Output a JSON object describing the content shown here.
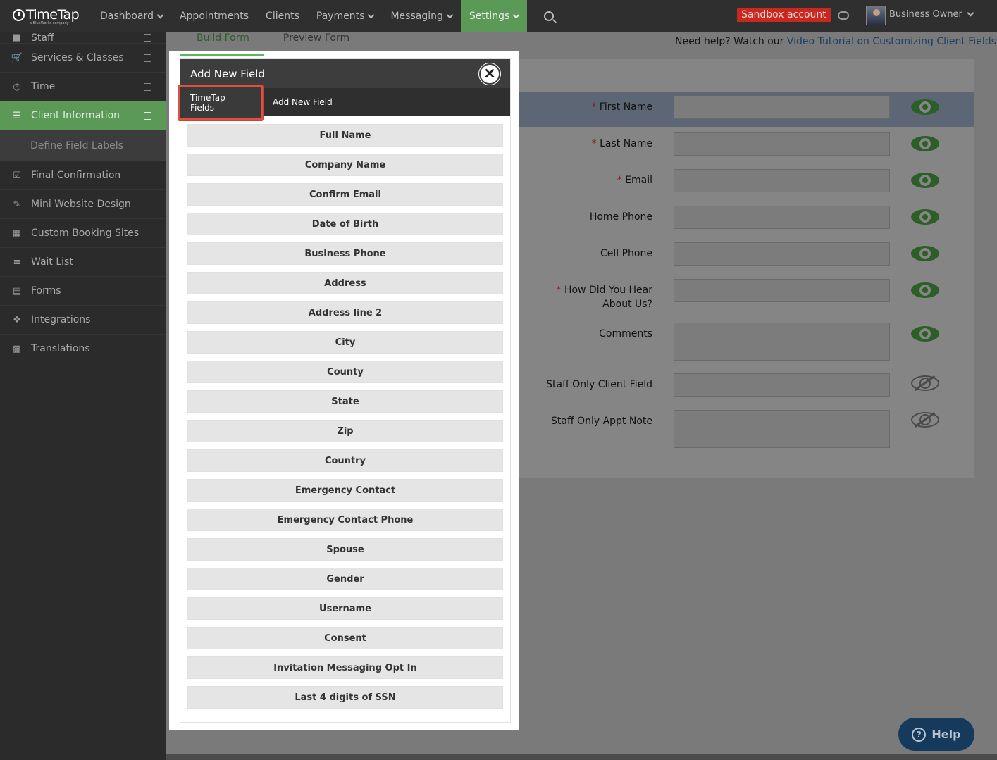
{
  "topbar": {
    "logo": "TimeTap",
    "logo_sub": "a BlueWorks company",
    "nav": [
      {
        "label": "Dashboard",
        "dropdown": true,
        "active": false
      },
      {
        "label": "Appointments",
        "dropdown": false,
        "active": false
      },
      {
        "label": "Clients",
        "dropdown": false,
        "active": false
      },
      {
        "label": "Payments",
        "dropdown": true,
        "active": false
      },
      {
        "label": "Messaging",
        "dropdown": true,
        "active": false
      },
      {
        "label": "Settings",
        "dropdown": true,
        "active": true
      }
    ],
    "sandbox_label": "Sandbox account",
    "user_name": "Business Owner"
  },
  "sidebar": {
    "items": [
      {
        "label": "Staff",
        "icon": "staff-icon"
      },
      {
        "label": "Services & Classes",
        "icon": "cart-icon"
      },
      {
        "label": "Time",
        "icon": "clock-icon"
      },
      {
        "label": "Client Information",
        "icon": "list-icon",
        "active": true
      },
      {
        "label": "Define Field Labels",
        "sub": true
      },
      {
        "label": "Final Confirmation",
        "icon": "checkbox-icon"
      },
      {
        "label": "Mini Website Design",
        "icon": "edit-icon"
      },
      {
        "label": "Custom Booking Sites",
        "icon": "sitemap-icon"
      },
      {
        "label": "Wait List",
        "icon": "wait-list-icon"
      },
      {
        "label": "Forms",
        "icon": "file-icon"
      },
      {
        "label": "Integrations",
        "icon": "puzzle-icon"
      },
      {
        "label": "Translations",
        "icon": "translate-icon"
      }
    ]
  },
  "main": {
    "tabs": [
      "Build Form",
      "Preview Form"
    ],
    "help_prefix": "Need help? Watch our ",
    "help_link": "Video Tutorial on Customizing Client Fields",
    "form_fields": [
      {
        "label": "First Name",
        "required": true,
        "visible": true
      },
      {
        "label": "Last Name",
        "required": true,
        "visible": true
      },
      {
        "label": "Email",
        "required": true,
        "visible": true
      },
      {
        "label": "Home Phone",
        "required": false,
        "visible": true
      },
      {
        "label": "Cell Phone",
        "required": false,
        "visible": true
      },
      {
        "label": "How Did You Hear About Us?",
        "required": true,
        "visible": true
      },
      {
        "label": "Comments",
        "required": false,
        "visible": true
      },
      {
        "label": "Staff Only Client Field",
        "required": false,
        "visible": false
      },
      {
        "label": "Staff Only Appt Note",
        "required": false,
        "visible": false
      }
    ],
    "help_button": "Help"
  },
  "modal": {
    "title": "Add New Field",
    "tabs": [
      "TimeTap Fields",
      "Add New Field"
    ],
    "fields": [
      "Full Name",
      "Company Name",
      "Confirm Email",
      "Date of Birth",
      "Business Phone",
      "Address",
      "Address line 2",
      "City",
      "County",
      "State",
      "Zip",
      "Country",
      "Emergency Contact",
      "Emergency Contact Phone",
      "Spouse",
      "Gender",
      "Username",
      "Consent",
      "Invitation Messaging Opt In",
      "Last 4 digits of SSN"
    ]
  },
  "colors": {
    "accent_green": "#5a9a56",
    "sandbox_red": "#c8281e",
    "highlight_outline": "#e05040",
    "link_blue": "#1c3f66"
  }
}
